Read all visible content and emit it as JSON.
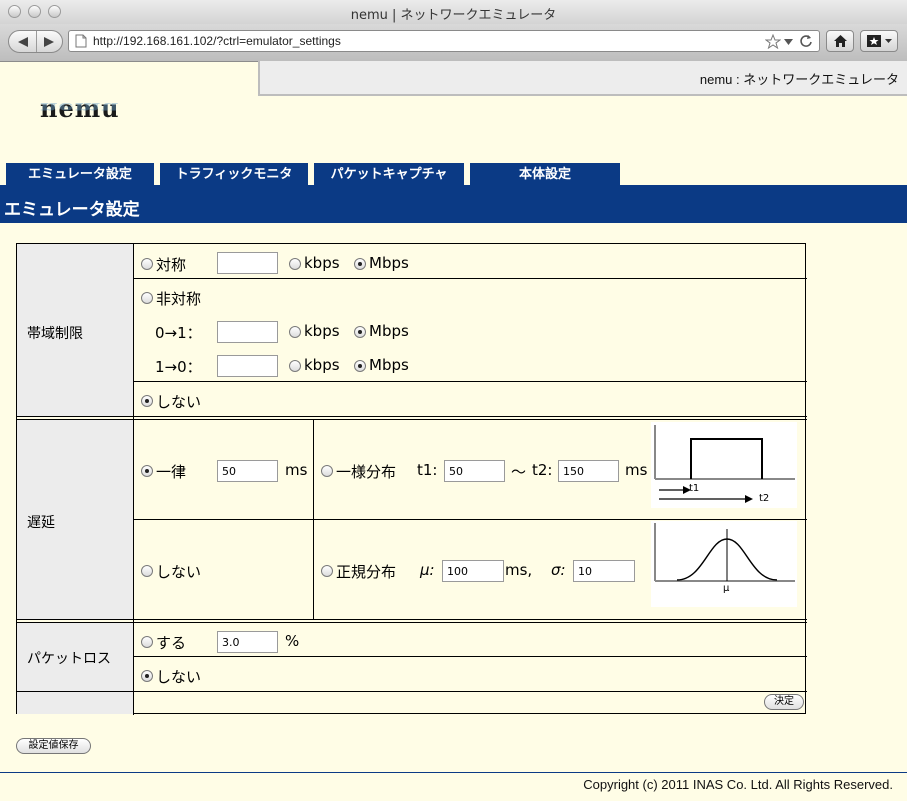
{
  "window": {
    "title": "nemu | ネットワークエミュレータ"
  },
  "browser": {
    "url": "http://192.168.161.102/?ctrl=emulator_settings"
  },
  "header": {
    "site_title": "nemu : ネットワークエミュレータ",
    "logo": "nemu"
  },
  "tabs": [
    {
      "label": "エミュレータ設定"
    },
    {
      "label": "トラフィックモニタ"
    },
    {
      "label": "パケットキャプチャ"
    },
    {
      "label": "本体設定"
    }
  ],
  "section": {
    "title": "エミュレータ設定"
  },
  "bandwidth": {
    "label": "帯域制限",
    "symmetric": {
      "label": "対称",
      "value": "",
      "unit_kbps": "kbps",
      "unit_mbps": "Mbps"
    },
    "asymmetric": {
      "label": "非対称",
      "dir_a": {
        "label": "0→1：",
        "value": "",
        "unit_kbps": "kbps",
        "unit_mbps": "Mbps"
      },
      "dir_b": {
        "label": "1→0：",
        "value": "",
        "unit_kbps": "kbps",
        "unit_mbps": "Mbps"
      }
    },
    "none": {
      "label": "しない"
    }
  },
  "delay": {
    "label": "遅延",
    "constant": {
      "label": "一律",
      "value": "50",
      "unit": "ms"
    },
    "uniform": {
      "label": "一様分布",
      "t1_label": "t1:",
      "t1": "50",
      "tilde": "〜",
      "t2_label": "t2:",
      "t2": "150",
      "unit": "ms"
    },
    "none": {
      "label": "しない"
    },
    "normal": {
      "label": "正規分布",
      "mu_label": "μ:",
      "mu": "100",
      "mu_unit": "ms,",
      "sigma_label": "σ:",
      "sigma": "10"
    },
    "diagram_uniform": {
      "t1": "t1",
      "t2": "t2"
    },
    "diagram_normal": {
      "mu": "μ"
    }
  },
  "packet_loss": {
    "label": "パケットロス",
    "on": {
      "label": "する",
      "value": "3.0",
      "unit": "%"
    },
    "none": {
      "label": "しない"
    }
  },
  "buttons": {
    "apply": "決定",
    "save": "設定値保存"
  },
  "footer": {
    "copyright": "Copyright (c) 2011 INAS Co. Ltd. All Rights Reserved."
  }
}
